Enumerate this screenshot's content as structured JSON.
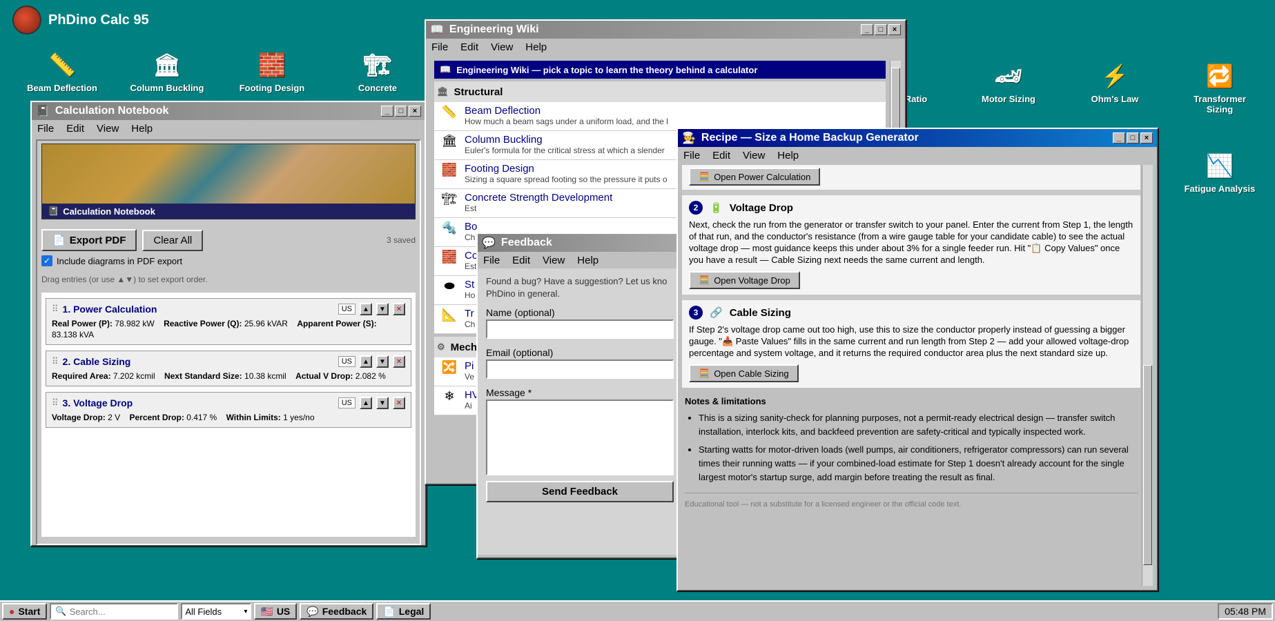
{
  "desktop": {
    "title": "PhDino Calc 95",
    "icons": [
      {
        "label": "Beam Deflection",
        "glyph": "📏"
      },
      {
        "label": "Column Buckling",
        "glyph": "🏛"
      },
      {
        "label": "Footing Design",
        "glyph": "🧱"
      },
      {
        "label": "Concrete",
        "glyph": "🏗"
      },
      {
        "label": "Ratio",
        "glyph": "⚙"
      },
      {
        "label": "Motor Sizing",
        "glyph": "🏎"
      },
      {
        "label": "Ohm's Law",
        "glyph": "⚡"
      },
      {
        "label": "Transformer Sizing",
        "glyph": "🔁"
      },
      {
        "label": "Fatigue Analysis",
        "glyph": "📉"
      }
    ]
  },
  "menu": {
    "file": "File",
    "edit": "Edit",
    "view": "View",
    "help": "Help"
  },
  "notebook": {
    "title": "Calculation Notebook",
    "banner": "Calculation Notebook",
    "export_label": "Export PDF",
    "clear_label": "Clear All",
    "saved_count": "3 saved",
    "include_label": "Include diagrams in PDF export",
    "hint": "Drag entries (or use ▲▼) to set export order.",
    "entries": [
      {
        "title": "1. Power Calculation",
        "unit": "US",
        "line1": [
          [
            "Real Power (P):",
            "78.982 kW"
          ],
          [
            "Reactive Power (Q):",
            "25.96 kVAR"
          ],
          [
            "Apparent Power (S):",
            ""
          ]
        ],
        "line2": "83.138 kVA"
      },
      {
        "title": "2. Cable Sizing",
        "unit": "US",
        "line1": [
          [
            "Required Area:",
            "7.202 kcmil"
          ],
          [
            "Next Standard Size:",
            "10.38 kcmil"
          ],
          [
            "Actual V Drop:",
            "2.082 %"
          ]
        ]
      },
      {
        "title": "3. Voltage Drop",
        "unit": "US",
        "line1": [
          [
            "Voltage Drop:",
            "2 V"
          ],
          [
            "Percent Drop:",
            "0.417 %"
          ],
          [
            "Within Limits:",
            "1 yes/no"
          ]
        ]
      }
    ]
  },
  "wiki": {
    "title": "Engineering Wiki",
    "header": "Engineering Wiki — pick a topic to learn the theory behind a calculator",
    "section1": "Structural",
    "section2": "Mech",
    "items": [
      {
        "name": "Beam Deflection",
        "desc": "How much a beam sags under a uniform load, and the l",
        "glyph": "📏"
      },
      {
        "name": "Column Buckling",
        "desc": "Euler's formula for the critical stress at which a slender",
        "glyph": "🏛"
      },
      {
        "name": "Footing Design",
        "desc": "Sizing a square spread footing so the pressure it puts o",
        "glyph": "🧱"
      },
      {
        "name": "Concrete Strength Development",
        "desc": "Est",
        "glyph": "🏗"
      },
      {
        "name": "Bo",
        "desc": "Ch",
        "glyph": "🔩"
      },
      {
        "name": "Co",
        "desc": "Est",
        "glyph": "🧱"
      },
      {
        "name": "St",
        "desc": "Ho",
        "glyph": "⬬"
      },
      {
        "name": "Tr",
        "desc": "Ch",
        "glyph": "📐"
      }
    ],
    "items2": [
      {
        "name": "Pi",
        "desc": "Ve",
        "glyph": "🔀"
      },
      {
        "name": "HV",
        "desc": "Ai",
        "glyph": "❄"
      }
    ]
  },
  "feedback": {
    "title": "Feedback",
    "intro": "Found a bug? Have a suggestion? Let us kno",
    "intro2": "PhDino in general.",
    "name_label": "Name (optional)",
    "email_label": "Email (optional)",
    "message_label": "Message *",
    "send_label": "Send Feedback"
  },
  "recipe": {
    "title": "Recipe — Size a Home Backup Generator",
    "open_power": "Open Power Calculation",
    "step2_no": "2",
    "step2_title": "Voltage Drop",
    "step2_text": "Next, check the run from the generator or transfer switch to your panel. Enter the current from Step 1, the length of that run, and the conductor's resistance (from a wire gauge table for your candidate cable) to see the actual voltage drop — most guidance keeps this under about 3% for a single feeder run. Hit \"📋 Copy Values\" once you have a result — Cable Sizing next needs the same current and length.",
    "open_vdrop": "Open Voltage Drop",
    "step3_no": "3",
    "step3_title": "Cable Sizing",
    "step3_text": "If Step 2's voltage drop came out too high, use this to size the conductor properly instead of guessing a bigger gauge. \"📥 Paste Values\" fills in the same current and run length from Step 2 — add your allowed voltage-drop percentage and system voltage, and it returns the required conductor area plus the next standard size up.",
    "open_cable": "Open Cable Sizing",
    "notes_title": "Notes & limitations",
    "notes": [
      "This is a sizing sanity-check for planning purposes, not a permit-ready electrical design — transfer switch installation, interlock kits, and backfeed prevention are safety-critical and typically inspected work.",
      "Starting watts for motor-driven loads (well pumps, air conditioners, refrigerator compressors) can run several times their running watts — if your combined-load estimate for Step 1 doesn't already account for the single largest motor's startup surge, add margin before treating the result as final."
    ],
    "disclaimer": "Educational tool — not a substitute for a licensed engineer or the official code text."
  },
  "taskbar": {
    "start": "Start",
    "search_placeholder": "Search...",
    "filter": "All Fields",
    "units": "US",
    "feedback": "Feedback",
    "legal": "Legal",
    "clock": "05:48 PM"
  }
}
